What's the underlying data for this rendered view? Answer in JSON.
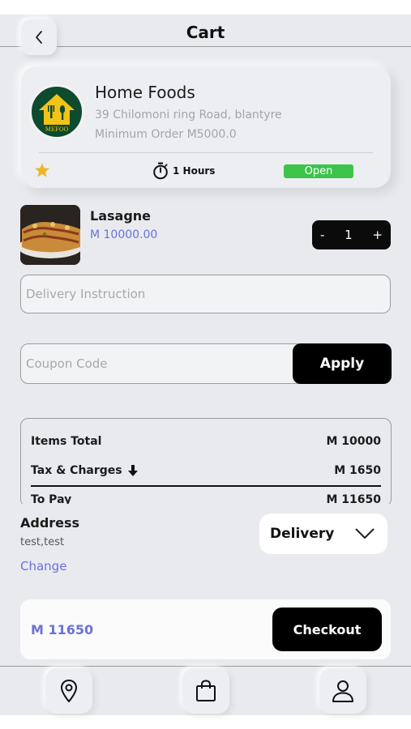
{
  "header": {
    "title": "Cart"
  },
  "restaurant": {
    "name": "Home Foods",
    "address": "39 Chilomoni ring Road, blantyre",
    "min_order": "Minimum Order M5000.0",
    "logo_text": "MEFOO",
    "delivery_time": "1 Hours",
    "status": "Open"
  },
  "item": {
    "name": "Lasagne",
    "price": "M 10000.00",
    "quantity": "1",
    "minus": "-",
    "plus": "+"
  },
  "delivery_instruction": {
    "placeholder": "Delivery Instruction",
    "value": ""
  },
  "coupon": {
    "placeholder": "Coupon Code",
    "value": "",
    "apply_label": "Apply"
  },
  "totals": {
    "items_total_label": "Items Total",
    "items_total_value": "M 10000",
    "tax_label": "Tax & Charges",
    "tax_value": "M 1650",
    "to_pay_label": "To Pay",
    "to_pay_value": "M 11650"
  },
  "address": {
    "title": "Address",
    "value": "test,test",
    "change_label": "Change"
  },
  "order_mode": {
    "selected": "Delivery"
  },
  "checkout": {
    "total": "M 11650",
    "button_label": "Checkout"
  },
  "nav": {
    "items": [
      "location-icon",
      "shopping-bag-icon",
      "profile-icon"
    ]
  },
  "colors": {
    "accent": "#6a72d8",
    "open_badge": "#3cc44a",
    "background": "#e9eaee",
    "button": "#000000"
  }
}
